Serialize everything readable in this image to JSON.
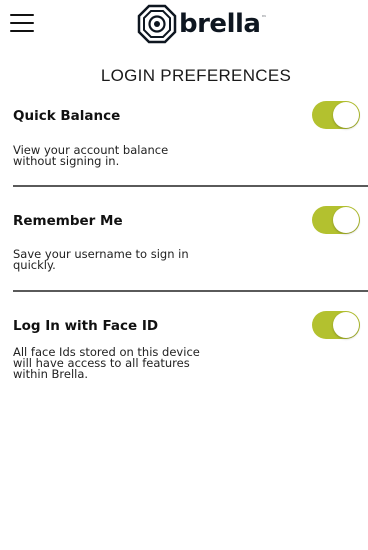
{
  "header": {
    "brand_name": "brella",
    "brand_tm": "™"
  },
  "page_title": "LOGIN PREFERENCES",
  "preferences": [
    {
      "label": "Quick Balance",
      "description": "View your account balance without signing in.",
      "enabled": true
    },
    {
      "label": "Remember Me",
      "description": "Save your username to sign in quickly.",
      "enabled": true
    },
    {
      "label": "Log In with Face ID",
      "description": "All face Ids stored on this device will have access to all features within Brella.",
      "enabled": true
    }
  ],
  "colors": {
    "toggle_on": "#b3c12f",
    "brand": "#0e1620",
    "divider": "#5a5a5a"
  }
}
